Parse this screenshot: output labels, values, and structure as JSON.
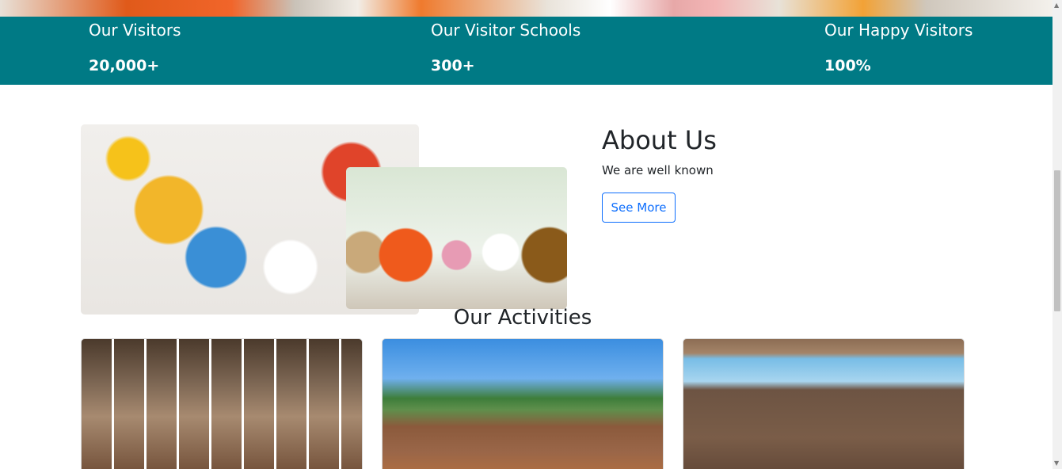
{
  "stats": [
    {
      "label": "Our Visitors",
      "value": "20,000+"
    },
    {
      "label": "Our Visitor Schools",
      "value": "300+"
    },
    {
      "label": "Our Happy Visitors",
      "value": "100%"
    }
  ],
  "about": {
    "title": "About Us",
    "subtitle": "We are well known",
    "button_label": "See More"
  },
  "activities": {
    "title": "Our Activities"
  },
  "icons": {
    "scroll_up": "▲",
    "scroll_down": "▼"
  },
  "colors": {
    "stats_band": "#007a85",
    "button_accent": "#0d6efd"
  }
}
